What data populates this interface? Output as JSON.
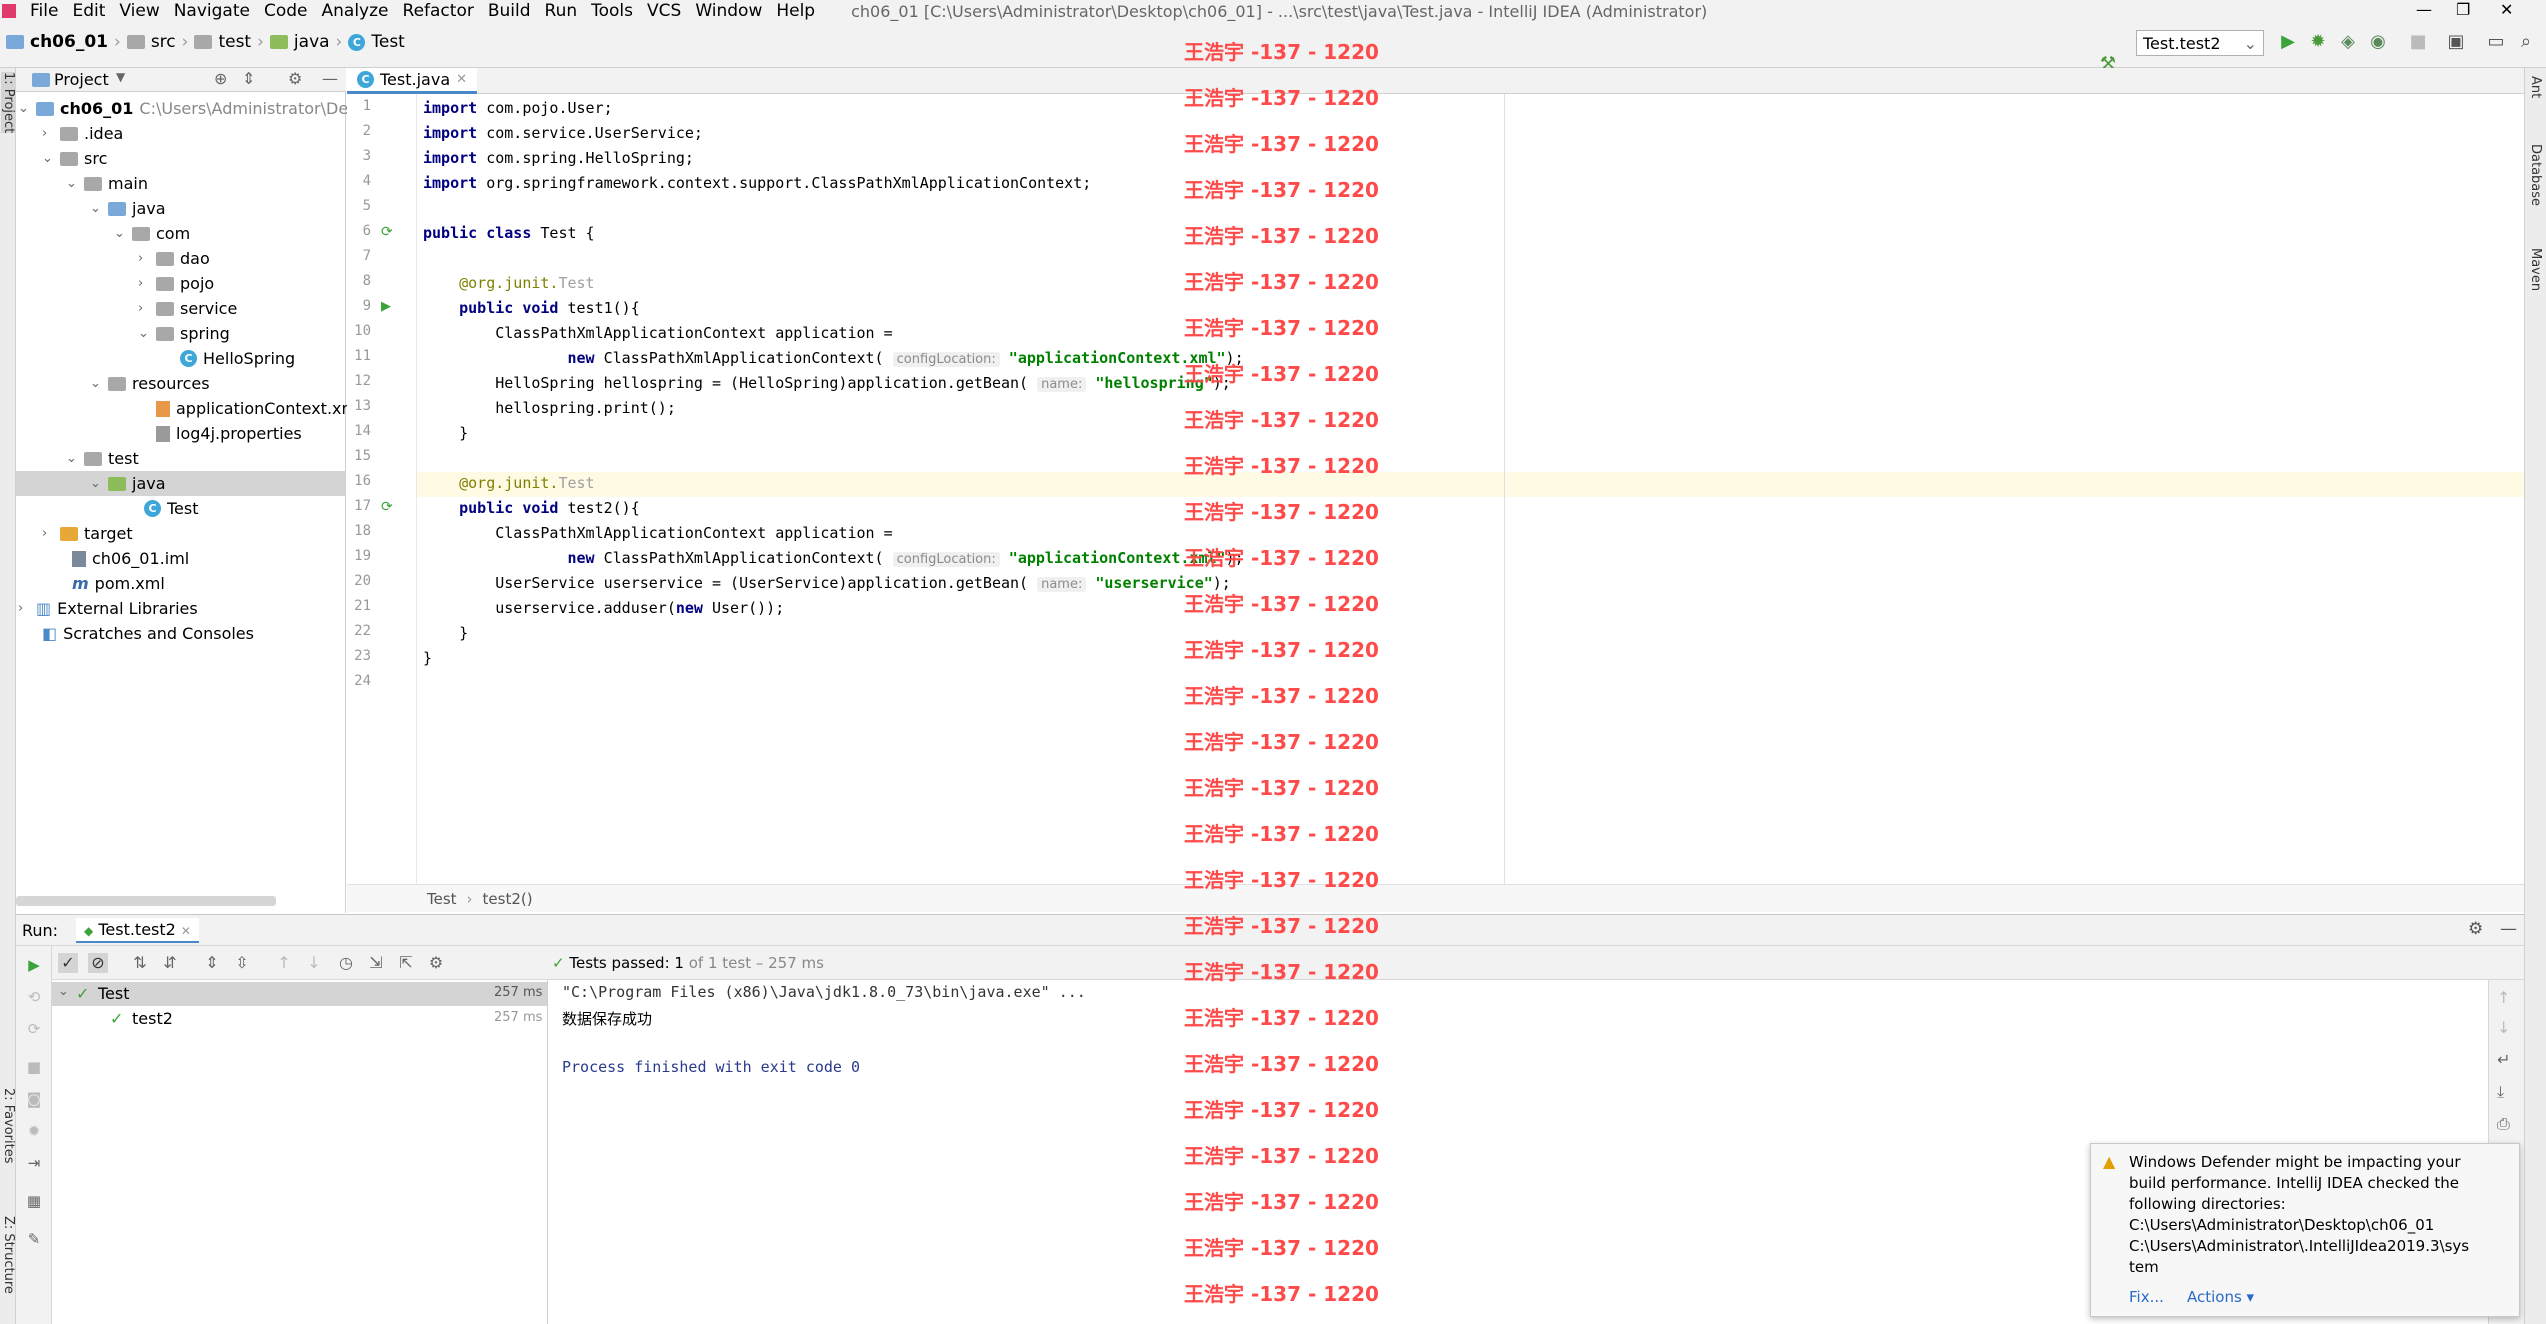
{
  "menu": {
    "items": [
      "File",
      "Edit",
      "View",
      "Navigate",
      "Code",
      "Analyze",
      "Refactor",
      "Build",
      "Run",
      "Tools",
      "VCS",
      "Window",
      "Help"
    ],
    "window_title": "ch06_01 [C:\\Users\\Administrator\\Desktop\\ch06_01] - ...\\src\\test\\java\\Test.java - IntelliJ IDEA (Administrator)"
  },
  "breadcrumb": [
    "ch06_01",
    "src",
    "test",
    "java",
    "Test"
  ],
  "toolbar": {
    "run_config": "Test.test2"
  },
  "project": {
    "title": "Project",
    "root_name": "ch06_01",
    "root_path": "C:\\Users\\Administrator\\Deskt",
    "tree": [
      {
        "label": ".idea"
      },
      {
        "label": "src"
      },
      {
        "label": "main"
      },
      {
        "label": "java"
      },
      {
        "label": "com"
      },
      {
        "label": "dao"
      },
      {
        "label": "pojo"
      },
      {
        "label": "service"
      },
      {
        "label": "spring"
      },
      {
        "label": "HelloSpring"
      },
      {
        "label": "resources"
      },
      {
        "label": "applicationContext.xml"
      },
      {
        "label": "log4j.properties"
      },
      {
        "label": "test"
      },
      {
        "label": "java"
      },
      {
        "label": "Test"
      },
      {
        "label": "target"
      },
      {
        "label": "ch06_01.iml"
      },
      {
        "label": "pom.xml"
      },
      {
        "label": "External Libraries"
      },
      {
        "label": "Scratches and Consoles"
      }
    ]
  },
  "editor": {
    "tab": "Test.java",
    "line_numbers": [
      "1",
      "2",
      "3",
      "4",
      "5",
      "6",
      "7",
      "8",
      "9",
      "10",
      "11",
      "12",
      "13",
      "14",
      "15",
      "16",
      "17",
      "18",
      "19",
      "20",
      "21",
      "22",
      "23",
      "24"
    ],
    "breadcrumb": [
      "Test",
      "test2()"
    ]
  },
  "run": {
    "label": "Run:",
    "tab": "Test.test2",
    "status_prefix": "Tests passed:",
    "status_count": "1",
    "status_rest": "of 1 test – 257 ms",
    "tree": [
      {
        "name": "Test",
        "time": "257 ms"
      },
      {
        "name": "test2",
        "time": "257 ms"
      }
    ],
    "console": [
      "\"C:\\Program Files (x86)\\Java\\jdk1.8.0_73\\bin\\java.exe\" ...",
      "数据保存成功",
      "",
      "Process finished with exit code 0"
    ]
  },
  "notification": {
    "message": "Windows Defender might be impacting your build performance. IntelliJ IDEA checked the following directories:",
    "dir1": "C:\\Users\\Administrator\\Desktop\\ch06_01",
    "dir2": "C:\\Users\\Administrator\\.IntelliJIdea2019.3\\sys",
    "dir2b": "tem",
    "fix": "Fix...",
    "actions": "Actions ▾"
  },
  "side_tabs": {
    "left_top": "1: Project",
    "left_fav": "2: Favorites",
    "left_struct": "Z: Structure",
    "right_ant": "Ant",
    "right_db": "Database",
    "right_maven": "Maven"
  },
  "watermark": "王浩宇 -137 - 1220"
}
